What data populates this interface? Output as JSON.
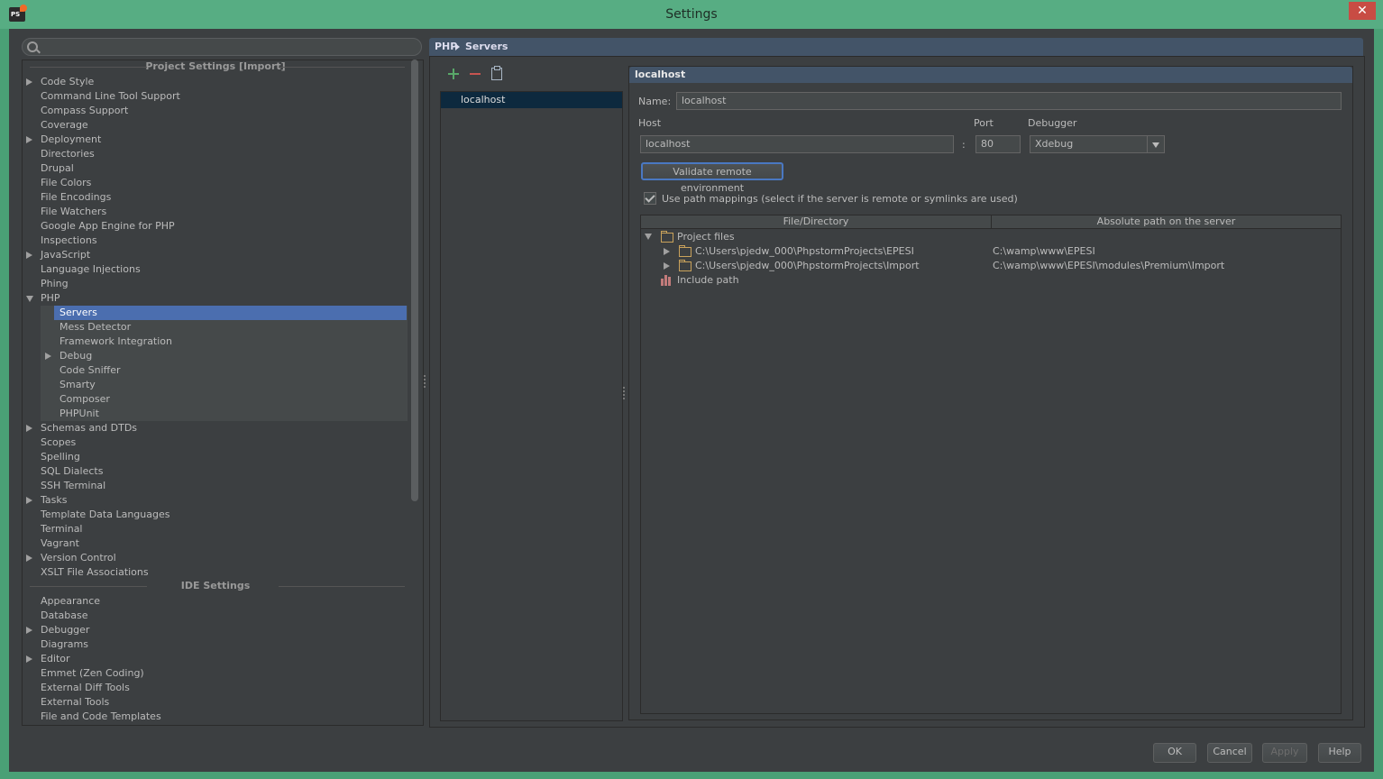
{
  "window": {
    "title": "Settings",
    "close_glyph": "✕",
    "app_icon_text": "PS"
  },
  "search": {
    "placeholder": "",
    "value": ""
  },
  "tree": {
    "project_header": "Project Settings [Import]",
    "ide_header": "IDE Settings",
    "project_items": [
      {
        "label": "Code Style",
        "expand": "collapsed"
      },
      {
        "label": "Command Line Tool Support"
      },
      {
        "label": "Compass Support"
      },
      {
        "label": "Coverage"
      },
      {
        "label": "Deployment",
        "expand": "collapsed"
      },
      {
        "label": "Directories"
      },
      {
        "label": "Drupal"
      },
      {
        "label": "File Colors"
      },
      {
        "label": "File Encodings"
      },
      {
        "label": "File Watchers"
      },
      {
        "label": "Google App Engine for PHP"
      },
      {
        "label": "Inspections"
      },
      {
        "label": "JavaScript",
        "expand": "collapsed"
      },
      {
        "label": "Language Injections"
      },
      {
        "label": "Phing"
      },
      {
        "label": "PHP",
        "expand": "expanded"
      }
    ],
    "php_children": [
      {
        "label": "Servers",
        "selected": true
      },
      {
        "label": "Mess Detector"
      },
      {
        "label": "Framework Integration"
      },
      {
        "label": "Debug",
        "expand": "collapsed"
      },
      {
        "label": "Code Sniffer"
      },
      {
        "label": "Smarty"
      },
      {
        "label": "Composer"
      },
      {
        "label": "PHPUnit"
      }
    ],
    "project_items_after": [
      {
        "label": "Schemas and DTDs",
        "expand": "collapsed"
      },
      {
        "label": "Scopes"
      },
      {
        "label": "Spelling"
      },
      {
        "label": "SQL Dialects"
      },
      {
        "label": "SSH Terminal"
      },
      {
        "label": "Tasks",
        "expand": "collapsed"
      },
      {
        "label": "Template Data Languages"
      },
      {
        "label": "Terminal"
      },
      {
        "label": "Vagrant"
      },
      {
        "label": "Version Control",
        "expand": "collapsed"
      },
      {
        "label": "XSLT File Associations"
      }
    ],
    "ide_items": [
      {
        "label": "Appearance"
      },
      {
        "label": "Database"
      },
      {
        "label": "Debugger",
        "expand": "collapsed"
      },
      {
        "label": "Diagrams"
      },
      {
        "label": "Editor",
        "expand": "collapsed"
      },
      {
        "label": "Emmet (Zen Coding)"
      },
      {
        "label": "External Diff Tools"
      },
      {
        "label": "External Tools"
      },
      {
        "label": "File and Code Templates"
      }
    ]
  },
  "breadcrumb": {
    "parent": "PHP",
    "current": "Servers"
  },
  "servers": {
    "items": [
      "localhost"
    ]
  },
  "detail": {
    "title": "localhost",
    "name_label": "Name:",
    "name_value": "localhost",
    "host_label": "Host",
    "host_value": "localhost",
    "colon": ":",
    "port_label": "Port",
    "port_value": "80",
    "debugger_label": "Debugger",
    "debugger_value": "Xdebug",
    "validate_label": "Validate remote environment",
    "use_mappings_label": "Use path mappings (select if the server is remote or symlinks are used)",
    "use_mappings_checked": true,
    "table": {
      "col1": "File/Directory",
      "col2": "Absolute path on the server",
      "project_files": "Project files",
      "rows": [
        {
          "local": "C:\\Users\\pjedw_000\\PhpstormProjects\\EPESI",
          "remote": "C:\\wamp\\www\\EPESI"
        },
        {
          "local": "C:\\Users\\pjedw_000\\PhpstormProjects\\Import",
          "remote": "C:\\wamp\\www\\EPESI\\modules\\Premium\\Import"
        }
      ],
      "include_path": "Include path"
    }
  },
  "footer": {
    "ok": "OK",
    "cancel": "Cancel",
    "apply": "Apply",
    "help": "Help"
  },
  "colors": {
    "selection": "#4b6eaf",
    "title_bar": "#57ad83",
    "panel": "#3c3f41",
    "close": "#c84c44"
  }
}
